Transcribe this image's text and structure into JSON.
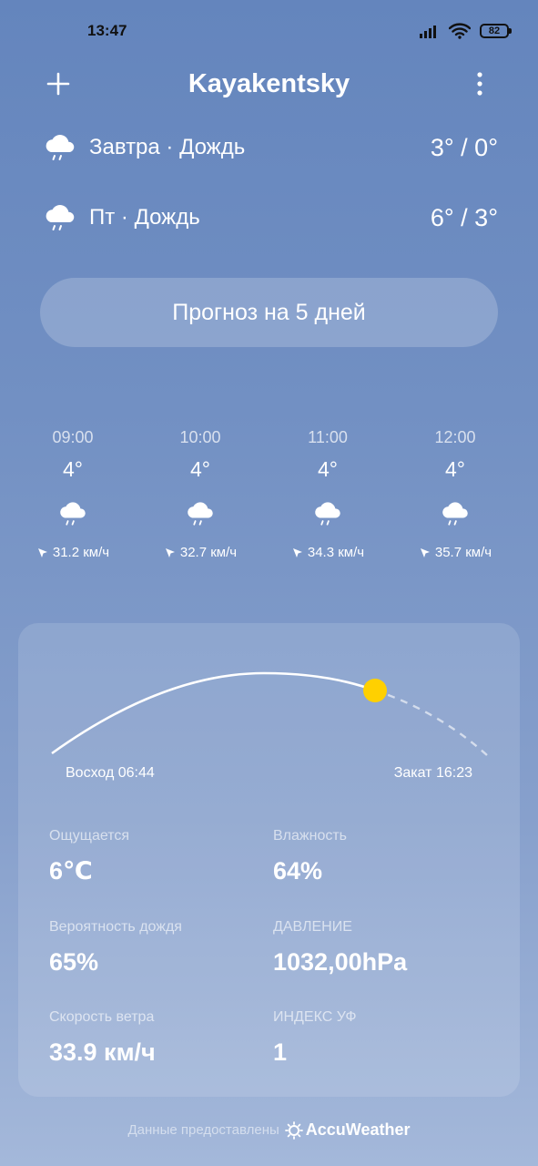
{
  "status_bar": {
    "time": "13:47",
    "battery": "82",
    "icons": [
      "signal-icon",
      "wifi-icon",
      "battery-icon"
    ]
  },
  "header": {
    "city": "Kayakentsky",
    "add_icon": "plus-icon",
    "menu_icon": "more-vertical-icon"
  },
  "daily": [
    {
      "label": "Завтра · Дождь",
      "temp": "3° / 0°",
      "icon": "rain-cloud-icon"
    },
    {
      "label": "Пт · Дождь",
      "temp": "6° / 3°",
      "icon": "rain-cloud-icon"
    }
  ],
  "forecast_button": "Прогноз на 5 дней",
  "hourly": [
    {
      "time": "09:00",
      "temp": "4°",
      "icon": "rain-cloud-icon",
      "wind": "31.2 км/ч"
    },
    {
      "time": "10:00",
      "temp": "4°",
      "icon": "rain-cloud-icon",
      "wind": "32.7 км/ч"
    },
    {
      "time": "11:00",
      "temp": "4°",
      "icon": "rain-cloud-icon",
      "wind": "34.3 км/ч"
    },
    {
      "time": "12:00",
      "temp": "4°",
      "icon": "rain-cloud-icon",
      "wind": "35.7 км/ч"
    }
  ],
  "sun": {
    "sunrise": "Восход 06:44",
    "sunset": "Закат 16:23",
    "sun_color": "#ffd000"
  },
  "metrics": {
    "feels_like": {
      "label": "Ощущается",
      "value": "6℃"
    },
    "humidity": {
      "label": "Влажность",
      "value": "64%"
    },
    "rain_chance": {
      "label": "Вероятность дождя",
      "value": "65%"
    },
    "pressure": {
      "label": "ДАВЛЕНИЕ",
      "value": "1032,00hPa"
    },
    "wind_speed": {
      "label": "Скорость ветра",
      "value": "33.9 км/ч"
    },
    "uv_index": {
      "label": "ИНДЕКС УФ",
      "value": "1"
    }
  },
  "footer": {
    "text": "Данные предоставлены",
    "brand": "AccuWeather"
  }
}
